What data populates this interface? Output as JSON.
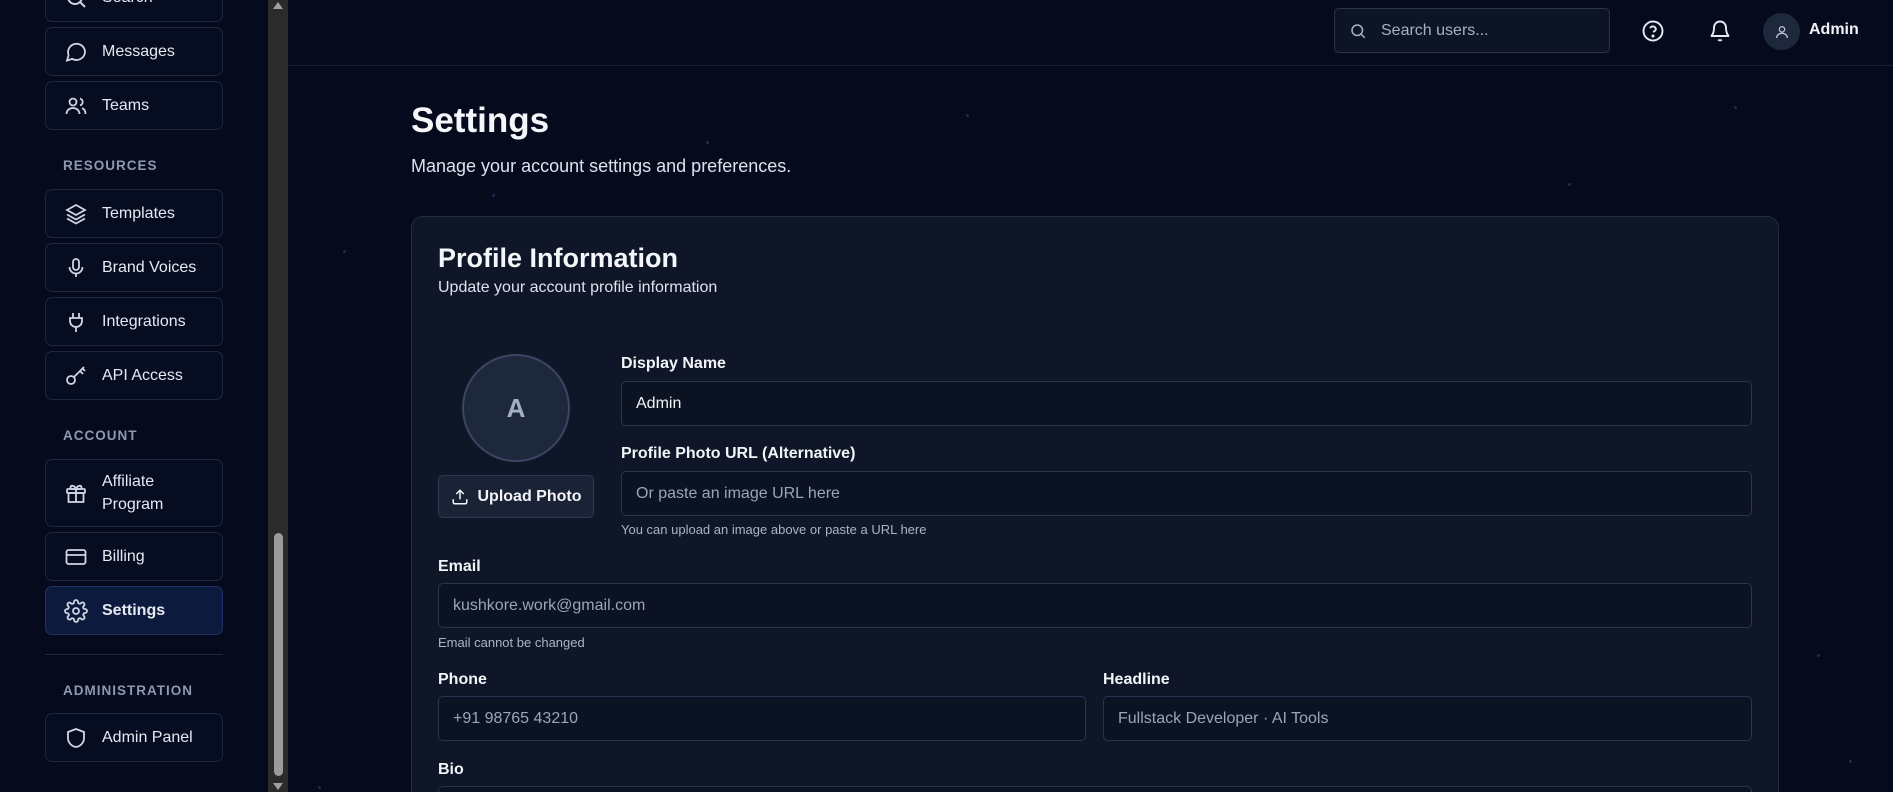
{
  "sidebar": {
    "items_top": [
      {
        "label": "Search",
        "icon": "search-icon"
      },
      {
        "label": "Messages",
        "icon": "message-icon"
      },
      {
        "label": "Teams",
        "icon": "users-icon"
      }
    ],
    "resources_title": "RESOURCES",
    "resources": [
      {
        "label": "Templates",
        "icon": "layers-icon"
      },
      {
        "label": "Brand Voices",
        "icon": "microphone-icon"
      },
      {
        "label": "Integrations",
        "icon": "plug-icon"
      },
      {
        "label": "API Access",
        "icon": "key-icon"
      }
    ],
    "account_title": "ACCOUNT",
    "account": [
      {
        "label": "Affiliate Program",
        "icon": "gift-icon"
      },
      {
        "label": "Billing",
        "icon": "credit-card-icon"
      },
      {
        "label": "Settings",
        "icon": "gear-icon"
      }
    ],
    "admin_title": "ADMINISTRATION",
    "admin": [
      {
        "label": "Admin Panel",
        "icon": "shield-icon"
      }
    ]
  },
  "topbar": {
    "search_placeholder": "Search users...",
    "user_name": "Admin"
  },
  "page": {
    "title": "Settings",
    "subtitle": "Manage your account settings and preferences."
  },
  "profile": {
    "title": "Profile Information",
    "subtitle": "Update your account profile information",
    "avatar_initial": "A",
    "upload_label": "Upload Photo",
    "display_name_label": "Display Name",
    "display_name_value": "Admin",
    "photo_url_label": "Profile Photo URL (Alternative)",
    "photo_url_placeholder": "Or paste an image URL here",
    "photo_url_hint": "You can upload an image above or paste a URL here",
    "email_label": "Email",
    "email_value": "kushkore.work@gmail.com",
    "email_hint": "Email cannot be changed",
    "phone_label": "Phone",
    "phone_placeholder": "+91 98765 43210",
    "headline_label": "Headline",
    "headline_placeholder": "Fullstack Developer · AI Tools",
    "bio_label": "Bio"
  },
  "colors": {
    "background": "#050a1c",
    "card": "#0e1627",
    "active_nav": "#0c1a3e"
  }
}
